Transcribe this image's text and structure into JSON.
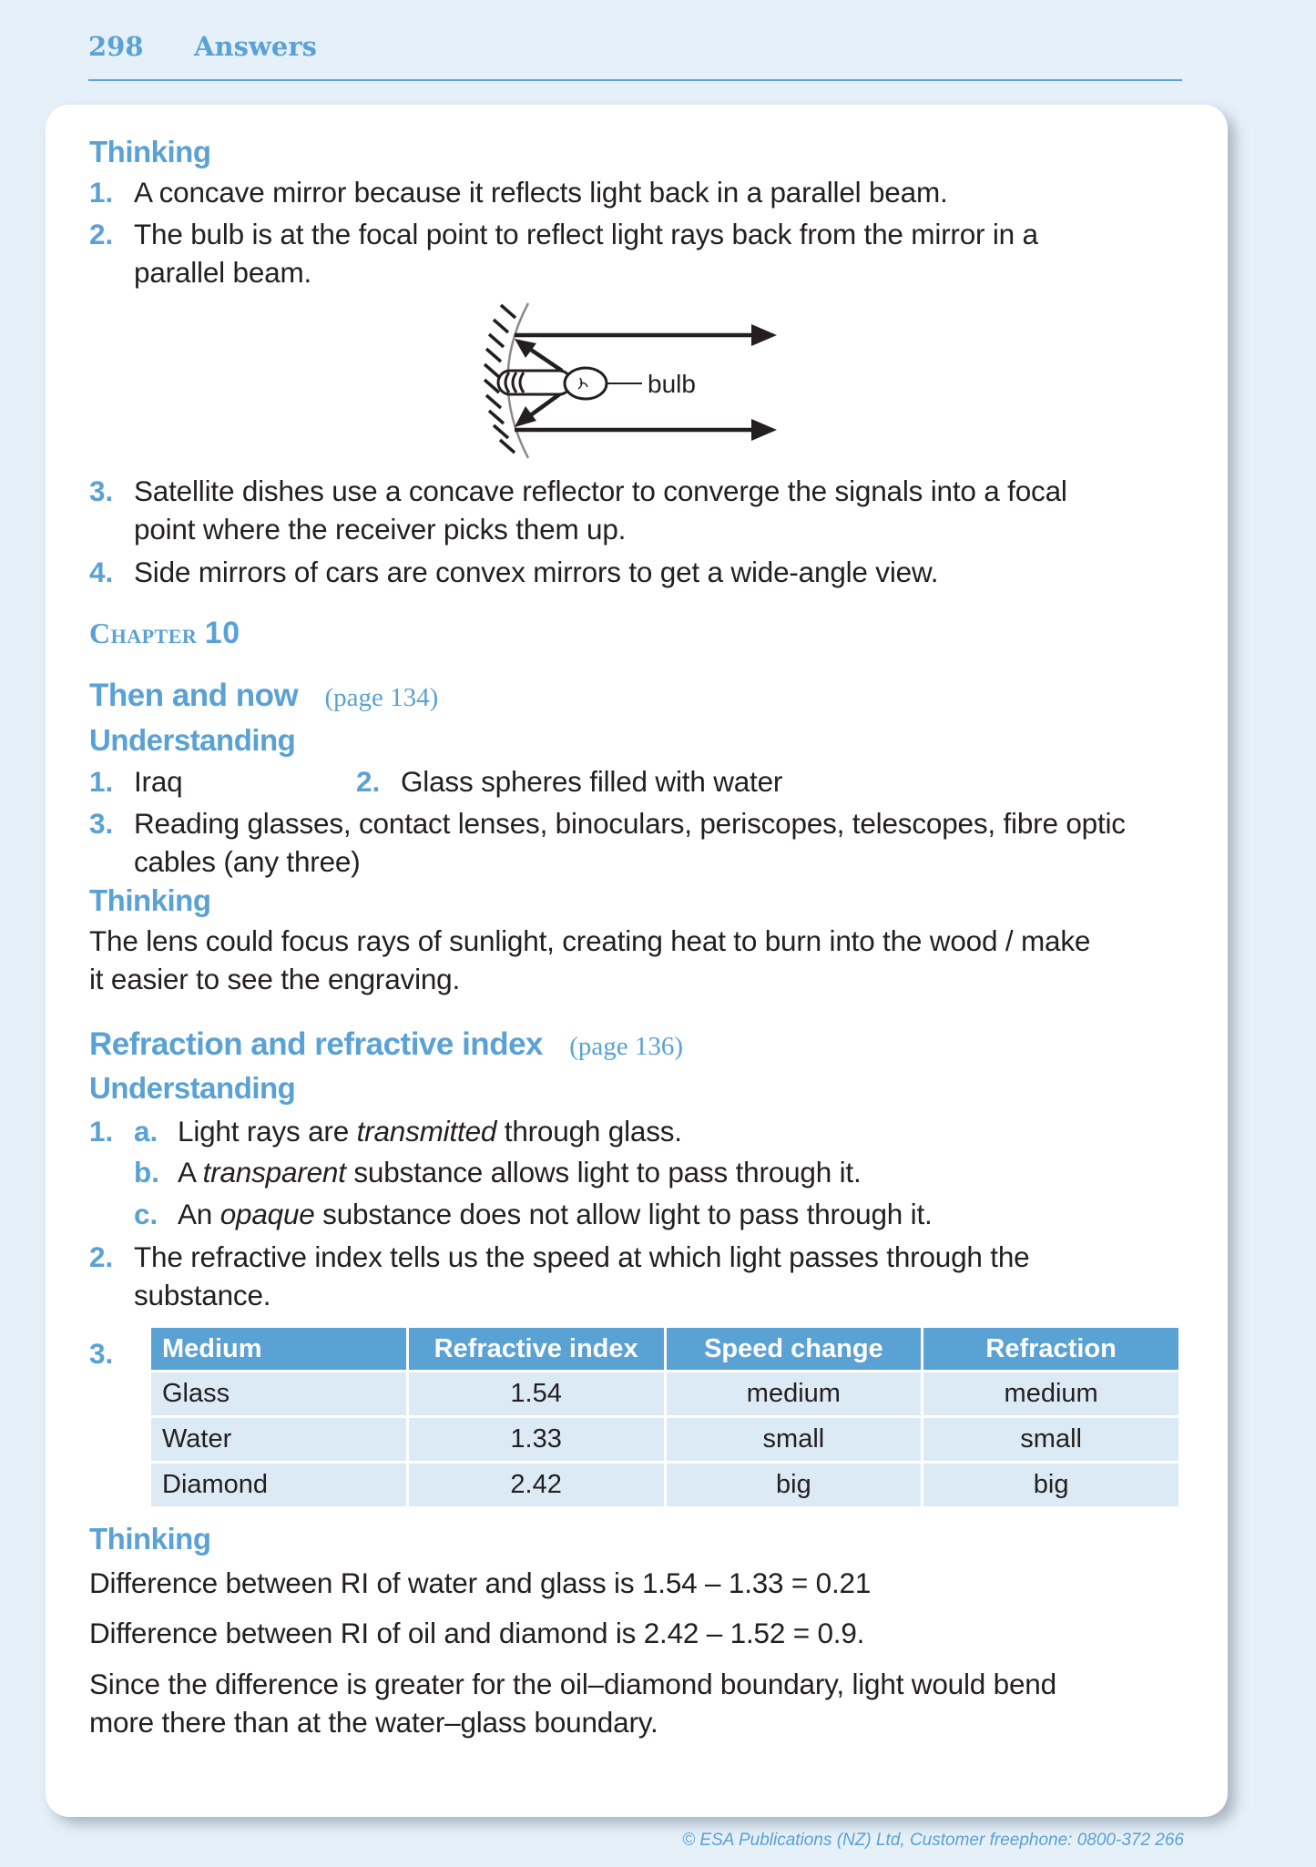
{
  "header": {
    "page_number": "298",
    "title": "Answers"
  },
  "section1": {
    "thinking_heading": "Thinking",
    "items": [
      {
        "num": "1.",
        "lines": [
          "A concave mirror because it reflects light back in a parallel beam."
        ]
      },
      {
        "num": "2.",
        "lines": [
          "The bulb is at the focal point to reflect light rays back from the mirror in a",
          "parallel beam."
        ]
      },
      {
        "num": "3.",
        "lines": [
          "Satellite dishes use a concave reflector to converge the signals into a focal",
          "point where the receiver picks them up."
        ]
      },
      {
        "num": "4.",
        "lines": [
          "Side mirrors of cars are convex mirrors to get a wide-angle view."
        ]
      }
    ],
    "diagram": {
      "label": "bulb",
      "description": "Concave mirror with bulb at focal point reflecting rays back as a parallel beam"
    }
  },
  "chapter": {
    "prefix": "Chapter",
    "number": "10"
  },
  "then_and_now": {
    "title": "Then and now",
    "page_ref": "(page 134)",
    "understanding_heading": "Understanding",
    "item1": {
      "num": "1.",
      "text": "Iraq"
    },
    "item2": {
      "num": "2.",
      "text": "Glass spheres filled with water"
    },
    "item3": {
      "num": "3.",
      "lines": [
        "Reading glasses, contact lenses, binoculars, periscopes, telescopes, fibre optic",
        "cables (any three)"
      ]
    },
    "thinking_heading": "Thinking",
    "thinking_lines": [
      "The lens could focus rays of sunlight, creating heat to burn into the wood / make",
      "it easier to see the engraving."
    ]
  },
  "refraction": {
    "title": "Refraction and refractive index",
    "page_ref": "(page 136)",
    "understanding_heading": "Understanding",
    "item1_num": "1.",
    "subitems": [
      {
        "letter": "a.",
        "before": "Light rays are ",
        "emph": "transmitted",
        "after": " through glass."
      },
      {
        "letter": "b.",
        "before": "A ",
        "emph": "transparent",
        "after": " substance allows light to pass through it."
      },
      {
        "letter": "c.",
        "before": "An ",
        "emph": "opaque",
        "after": " substance does not allow light to pass through it."
      }
    ],
    "item2": {
      "num": "2.",
      "lines": [
        "The refractive index tells us the speed at which light passes through the",
        "substance."
      ]
    },
    "item3_num": "3.",
    "table": {
      "headers": [
        "Medium",
        "Refractive index",
        "Speed change",
        "Refraction"
      ],
      "rows": [
        [
          "Glass",
          "1.54",
          "medium",
          "medium"
        ],
        [
          "Water",
          "1.33",
          "small",
          "small"
        ],
        [
          "Diamond",
          "2.42",
          "big",
          "big"
        ]
      ]
    },
    "thinking_heading": "Thinking",
    "thinking_para1": "Difference between RI of water and glass is 1.54 – 1.33 = 0.21",
    "thinking_para2": "Difference between RI of oil and diamond is 2.42 – 1.52 = 0.9.",
    "thinking_para3_lines": [
      "Since the difference is greater for the oil–diamond boundary, light would bend",
      "more there than at the water–glass boundary."
    ]
  },
  "footer": {
    "text": "© ESA Publications (NZ) Ltd, Customer freephone: 0800-372 266"
  },
  "colors": {
    "accent": "#5aa1d4",
    "page_bg": "#e5f0f9",
    "table_cell_bg": "#dceaf6",
    "text": "#231f20"
  }
}
